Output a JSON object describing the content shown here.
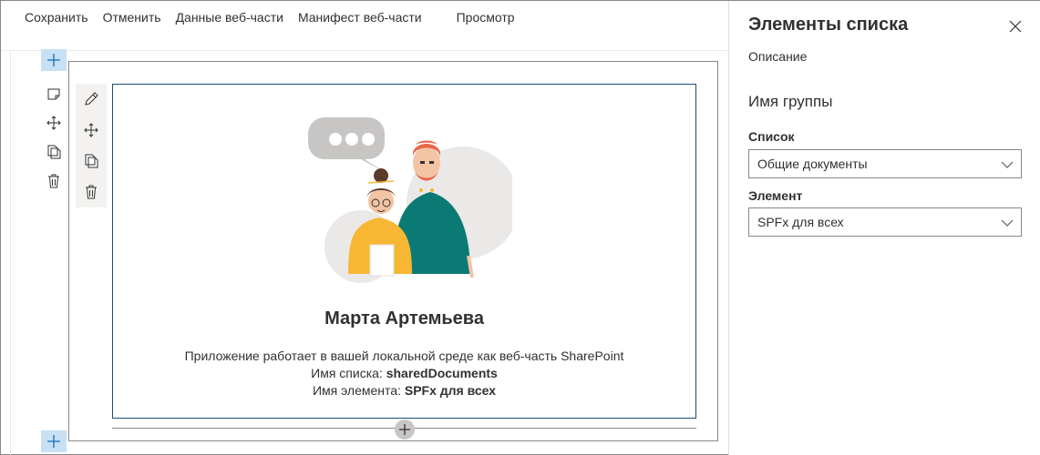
{
  "toolbar": {
    "items": [
      "Сохранить",
      "Отменить",
      "Данные веб-части",
      "Манифест веб-части"
    ],
    "preview": "Просмотр"
  },
  "webpart": {
    "name": "Марта Артемьева",
    "line1": "Приложение работает в вашей локальной среде как веб-часть SharePoint",
    "list_label": "Имя списка: ",
    "list_value": "sharedDocuments",
    "item_label": "Имя элемента: ",
    "item_value": "SPFx для всех"
  },
  "pane": {
    "title": "Элементы списка",
    "description": "Описание",
    "group_name": "Имя группы",
    "list_field_label": "Список",
    "list_field_value": "Общие документы",
    "item_field_label": "Элемент",
    "item_field_value": "SPFx для всех"
  },
  "colors": {
    "accent_light": "#c7e0f4",
    "webpart_border": "#1b4f72",
    "teal": "#0b7a75",
    "yellow": "#f7b733"
  },
  "icons": {
    "add": "plus-icon",
    "edit": "edit-icon",
    "move": "move-icon",
    "duplicate": "duplicate-icon",
    "delete": "trash-icon",
    "close": "close-icon",
    "chevron": "chevron-down-icon"
  }
}
